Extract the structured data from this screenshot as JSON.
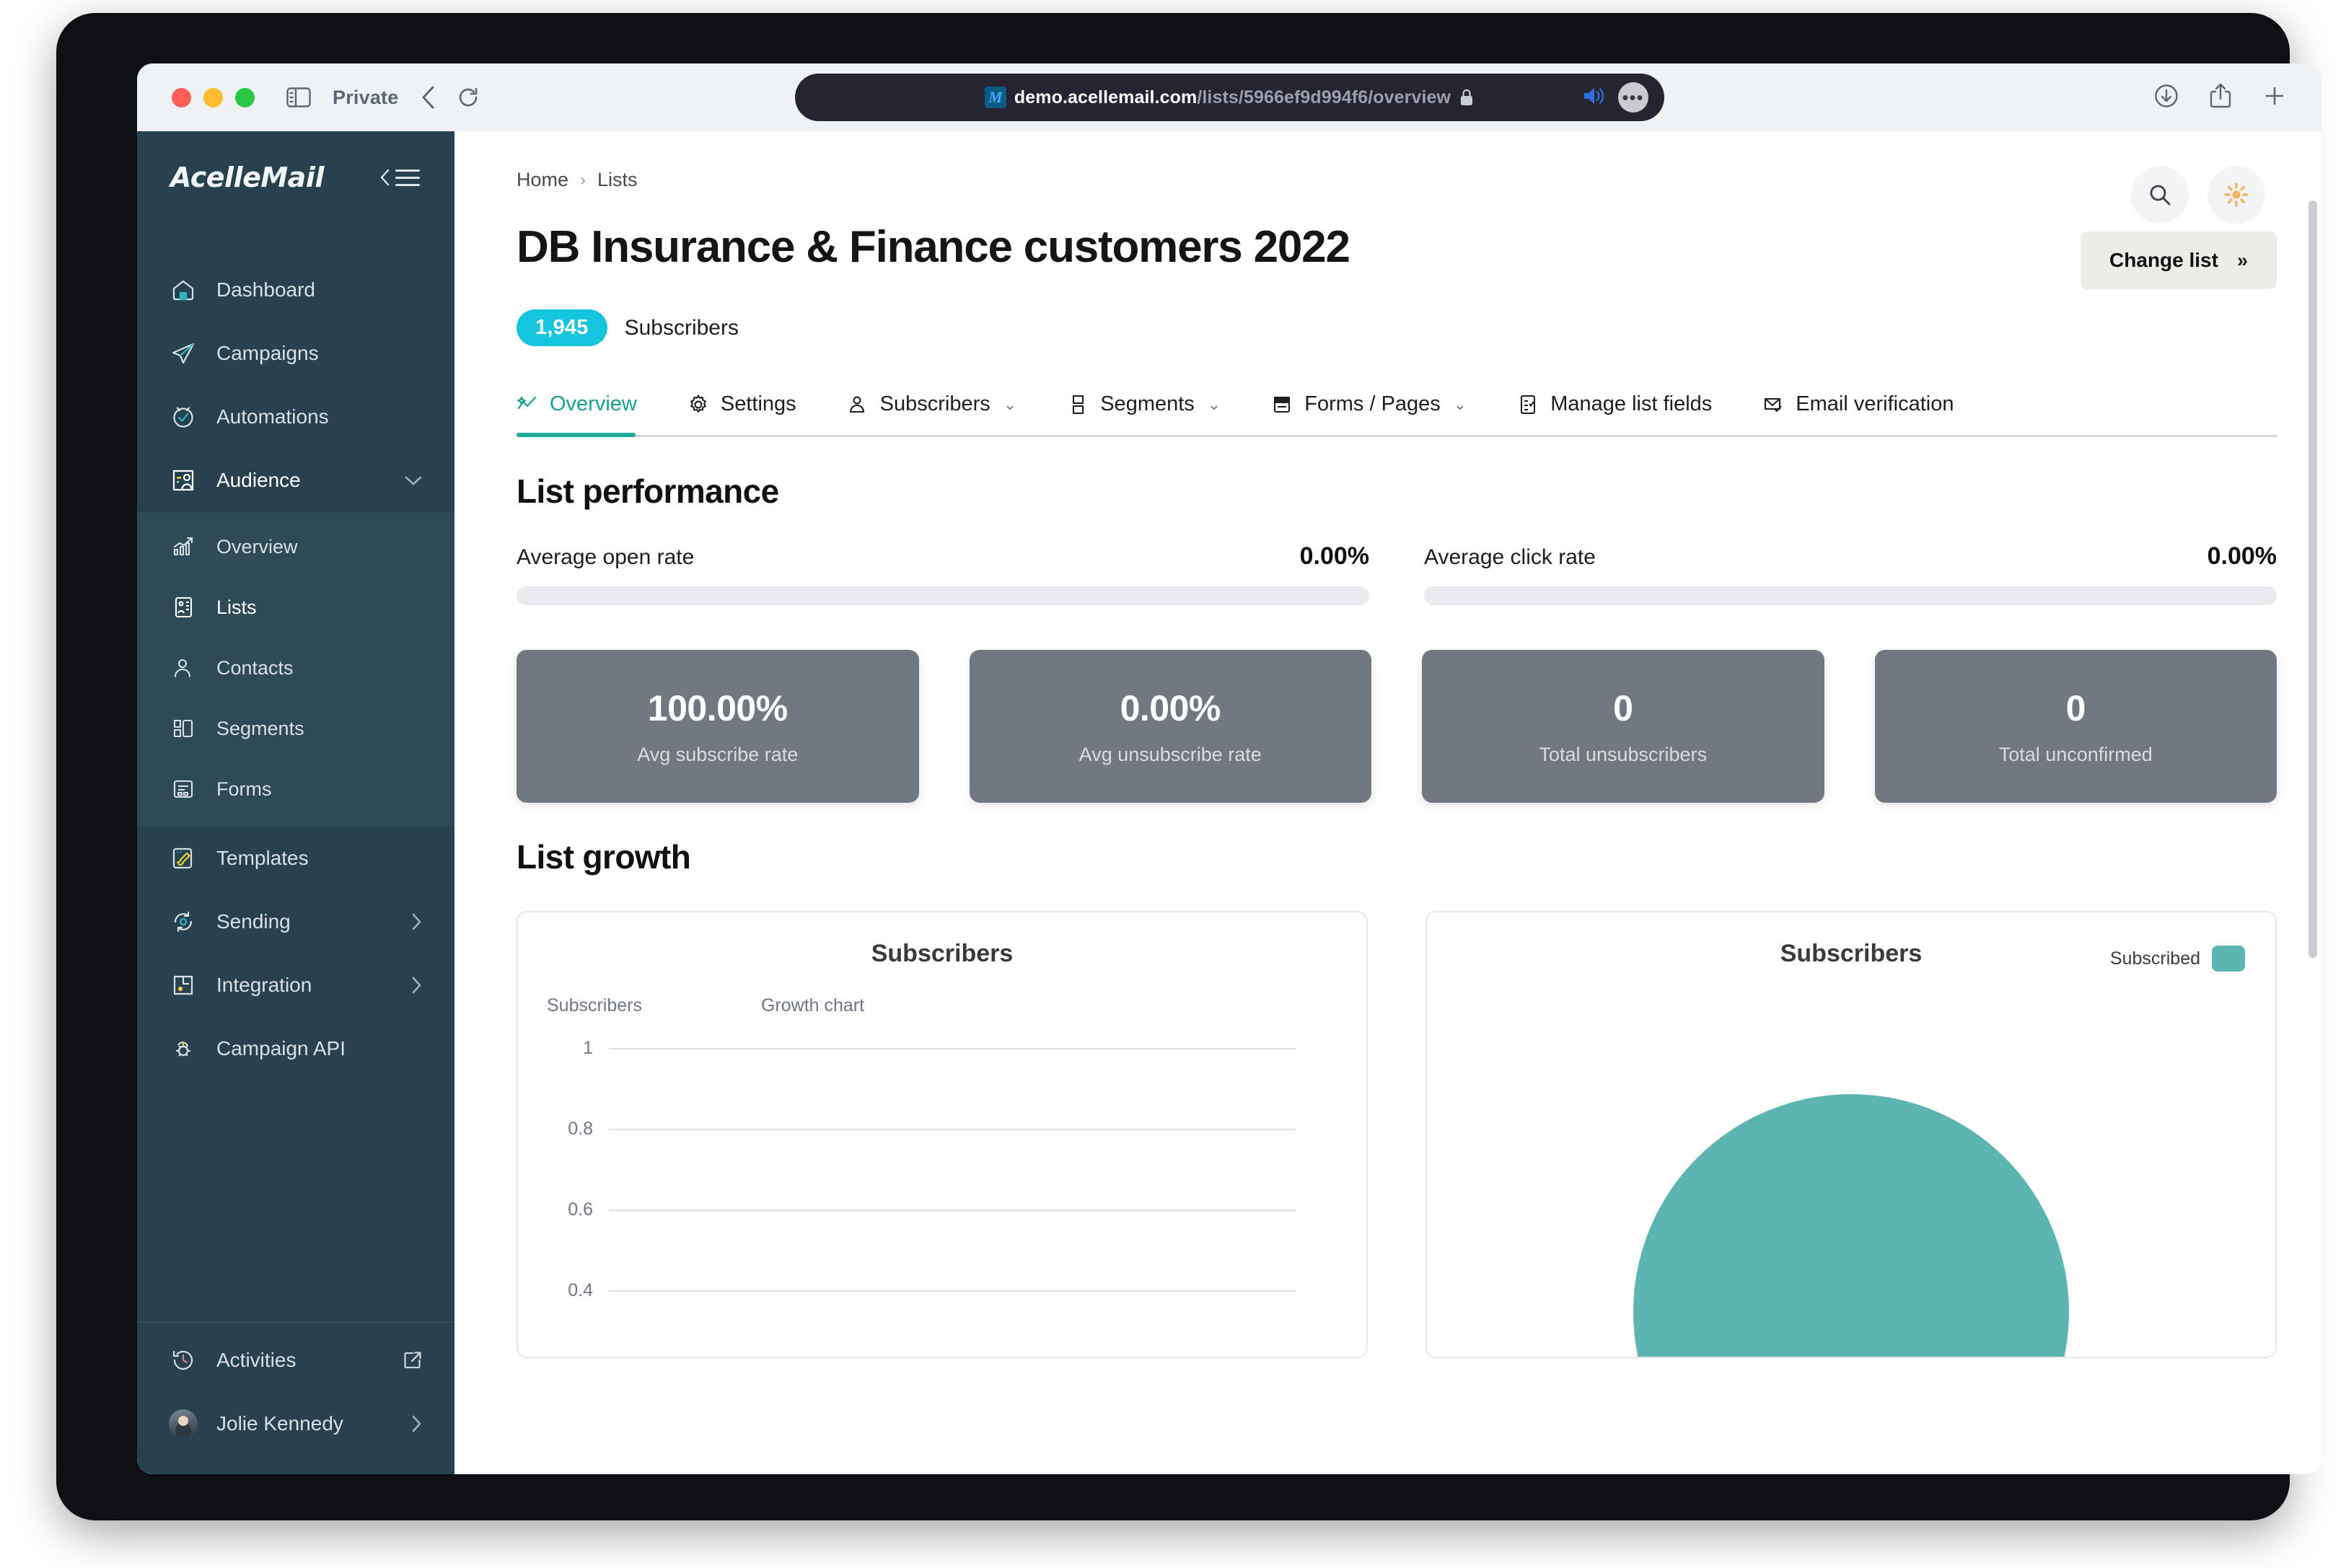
{
  "browser": {
    "private_label": "Private",
    "url_host": "demo.acellemail.com",
    "url_path": "/lists/5966ef9d994f6/overview",
    "favicon_letter": "M",
    "back_icon": "chevron-left-icon",
    "reload_icon": "reload-icon",
    "download_icon": "download-icon",
    "share_icon": "share-icon",
    "newtab_icon": "plus-icon",
    "audio_icon": "speaker-icon",
    "more_icon": "ellipsis-icon",
    "lock_icon": "lock-icon"
  },
  "sidebar": {
    "brand": "AcelleMail",
    "collapse_icon": "collapse-sidebar-icon",
    "items": [
      {
        "label": "Dashboard",
        "icon": "home-icon"
      },
      {
        "label": "Campaigns",
        "icon": "paper-plane-icon"
      },
      {
        "label": "Automations",
        "icon": "check-circle-icon"
      },
      {
        "label": "Audience",
        "icon": "audience-card-icon",
        "chevron": "chevron-down-icon",
        "active": true
      }
    ],
    "sub_items": [
      {
        "label": "Overview",
        "icon": "bar-chart-icon"
      },
      {
        "label": "Lists",
        "icon": "list-card-icon",
        "active": true
      },
      {
        "label": "Contacts",
        "icon": "user-icon"
      },
      {
        "label": "Segments",
        "icon": "segments-icon"
      },
      {
        "label": "Forms",
        "icon": "form-icon"
      }
    ],
    "items_after": [
      {
        "label": "Templates",
        "icon": "brush-icon"
      },
      {
        "label": "Sending",
        "icon": "sync-gear-icon",
        "chevron": "chevron-right-icon"
      },
      {
        "label": "Integration",
        "icon": "plug-icon",
        "chevron": "chevron-right-icon"
      },
      {
        "label": "Campaign API",
        "icon": "api-gear-icon"
      }
    ],
    "bottom": [
      {
        "label": "Activities",
        "icon": "history-icon",
        "trailing_icon": "external-link-icon"
      },
      {
        "label": "Jolie Kennedy",
        "icon": "avatar",
        "chevron": "chevron-right-icon"
      }
    ]
  },
  "header": {
    "breadcrumb": [
      "Home",
      "Lists"
    ],
    "breadcrumb_sep": "›",
    "title": "DB Insurance & Finance customers 2022",
    "change_list_label": "Change list",
    "change_list_chevron": "»",
    "subscriber_count": "1,945",
    "subscriber_label": "Subscribers",
    "search_icon": "search-icon",
    "theme_icon": "sun-icon"
  },
  "tabs": [
    {
      "label": "Overview",
      "icon": "activity-icon",
      "active": true
    },
    {
      "label": "Settings",
      "icon": "gear-icon"
    },
    {
      "label": "Subscribers",
      "icon": "user-icon",
      "chevron": "chevron-down-icon"
    },
    {
      "label": "Segments",
      "icon": "segments-icon",
      "chevron": "chevron-down-icon"
    },
    {
      "label": "Forms / Pages",
      "icon": "form-page-icon",
      "chevron": "chevron-down-icon"
    },
    {
      "label": "Manage list fields",
      "icon": "checklist-icon"
    },
    {
      "label": "Email verification",
      "icon": "mail-check-icon"
    }
  ],
  "performance": {
    "heading": "List performance",
    "rates": [
      {
        "name": "Average open rate",
        "value": "0.00%",
        "percent": 0
      },
      {
        "name": "Average click rate",
        "value": "0.00%",
        "percent": 0
      }
    ],
    "stats": [
      {
        "value": "100.00%",
        "label": "Avg subscribe rate"
      },
      {
        "value": "0.00%",
        "label": "Avg unsubscribe rate"
      },
      {
        "value": "0",
        "label": "Total unsubscribers"
      },
      {
        "value": "0",
        "label": "Total unconfirmed"
      }
    ]
  },
  "growth": {
    "heading": "List growth",
    "line_card": {
      "title": "Subscribers",
      "y_axis_label": "Subscribers",
      "subtitle": "Growth chart"
    },
    "pie_card": {
      "title": "Subscribers",
      "legend_label": "Subscribed",
      "legend_color": "#5cb5b0"
    }
  },
  "colors": {
    "sidebar_bg": "#27424e",
    "sidebar_sub_bg": "#2e4a57",
    "accent_teal": "#21a99a",
    "badge_cyan": "#15c5dd",
    "stat_card": "#71787f",
    "pie_teal": "#5cb5b0",
    "sun_orange": "#efb561"
  },
  "chart_data": [
    {
      "type": "line",
      "title": "Subscribers",
      "subtitle": "Growth chart",
      "xlabel": "",
      "ylabel": "Subscribers",
      "ylim": [
        0,
        1
      ],
      "yticks": [
        "1",
        "0.8",
        "0.6",
        "0.4"
      ],
      "grid": true,
      "series": [
        {
          "name": "Subscribers",
          "x": [],
          "values": []
        }
      ]
    },
    {
      "type": "pie",
      "title": "Subscribers",
      "legend_position": "top-right",
      "labels": [
        "Subscribed"
      ],
      "values": [
        100
      ],
      "colors": [
        "#5cb5b0"
      ]
    }
  ]
}
